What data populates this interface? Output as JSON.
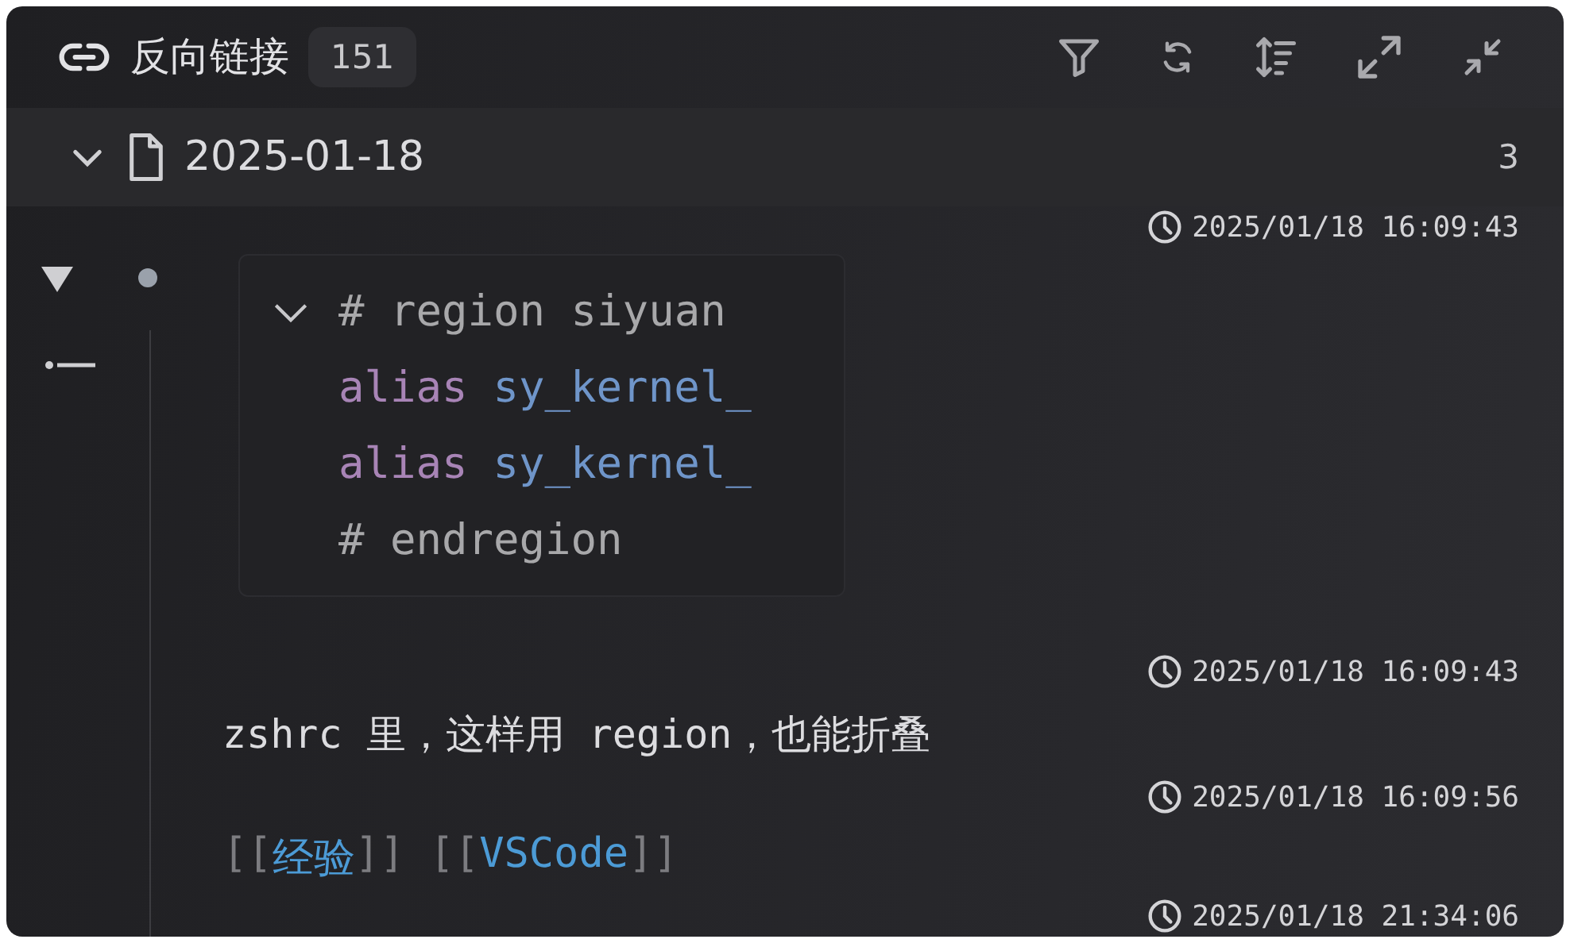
{
  "panel": {
    "title": "反向链接",
    "count": "151"
  },
  "file": {
    "name": "2025-01-18",
    "count": "3",
    "expanded": true
  },
  "entries": [
    {
      "kind": "timestamp",
      "text": "2025/01/18 16:09:43"
    },
    {
      "kind": "code",
      "folded": false,
      "lines": [
        [
          {
            "kind": "comment",
            "text": "# region siyuan"
          }
        ],
        [
          {
            "kind": "keyword",
            "text": "alias"
          },
          {
            "kind": "name",
            "text": "sy_kernel_"
          }
        ],
        [
          {
            "kind": "keyword",
            "text": "alias"
          },
          {
            "kind": "name",
            "text": "sy_kernel_"
          }
        ],
        [
          {
            "kind": "comment",
            "text": "# endregion"
          }
        ]
      ]
    },
    {
      "kind": "timestamp",
      "text": "2025/01/18 16:09:43"
    },
    {
      "kind": "text",
      "text": "zshrc 里，这样用 region，也能折叠"
    },
    {
      "kind": "timestamp",
      "text": "2025/01/18 16:09:56"
    },
    {
      "kind": "links",
      "parts": [
        {
          "kind": "bracket",
          "text": "[["
        },
        {
          "kind": "link",
          "text": "经验"
        },
        {
          "kind": "bracket",
          "text": "]] [["
        },
        {
          "kind": "link",
          "text": "VSCode"
        },
        {
          "kind": "bracket",
          "text": "]]"
        }
      ]
    },
    {
      "kind": "timestamp",
      "text": "2025/01/18 21:34:06"
    }
  ]
}
